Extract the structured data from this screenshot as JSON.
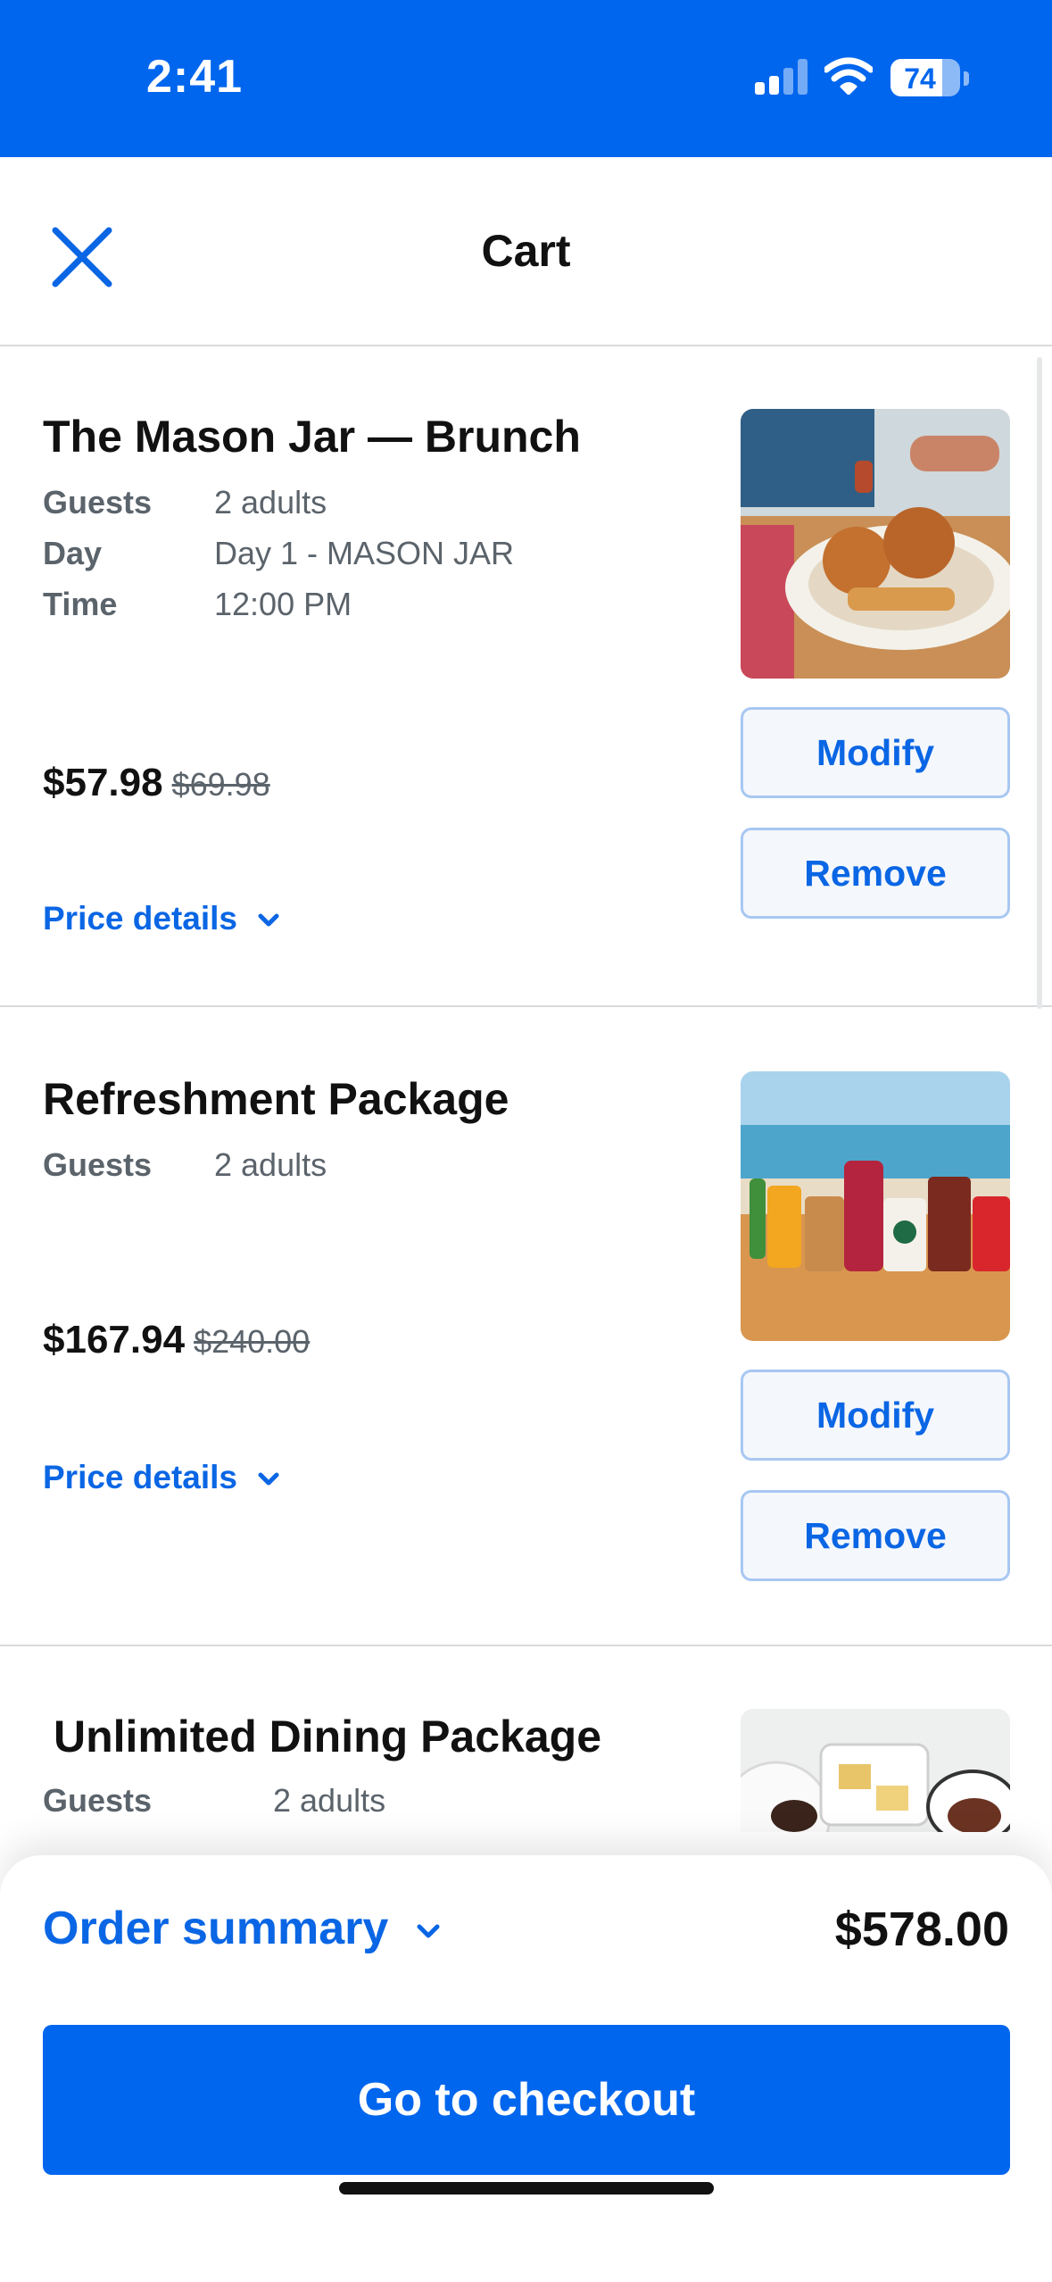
{
  "status_bar": {
    "time": "2:41",
    "battery_level": "74",
    "battery_fraction": 0.74,
    "signal_bars_active": 2,
    "signal_bars_total": 4,
    "background_color": "#0066ee"
  },
  "nav": {
    "title": "Cart",
    "close_icon": "close-x-icon"
  },
  "colors": {
    "accent": "#0a66e4",
    "brand_blue": "#0066ee",
    "muted_text": "#5b636b"
  },
  "cart": {
    "items": [
      {
        "title": "The Mason Jar — Brunch",
        "details": [
          {
            "label": "Guests",
            "value": "2 adults"
          },
          {
            "label": "Day",
            "value": "Day 1 - MASON JAR"
          },
          {
            "label": "Time",
            "value": "12:00 PM"
          }
        ],
        "price": "$57.98",
        "original_price": "$69.98",
        "price_details_label": "Price details",
        "modify_label": "Modify",
        "remove_label": "Remove",
        "image_icon": "chicken-waffles-photo"
      },
      {
        "title": "Refreshment Package",
        "details": [
          {
            "label": "Guests",
            "value": "2 adults"
          }
        ],
        "price": "$167.94",
        "original_price": "$240.00",
        "price_details_label": "Price details",
        "modify_label": "Modify",
        "remove_label": "Remove",
        "image_icon": "beverages-beach-photo"
      },
      {
        "title": "Unlimited Dining Package",
        "details": [
          {
            "label": "Guests",
            "value": "2 adults"
          }
        ],
        "image_icon": "dining-spread-photo"
      }
    ]
  },
  "summary": {
    "label": "Order summary",
    "total": "$578.00",
    "checkout_label": "Go to checkout"
  }
}
